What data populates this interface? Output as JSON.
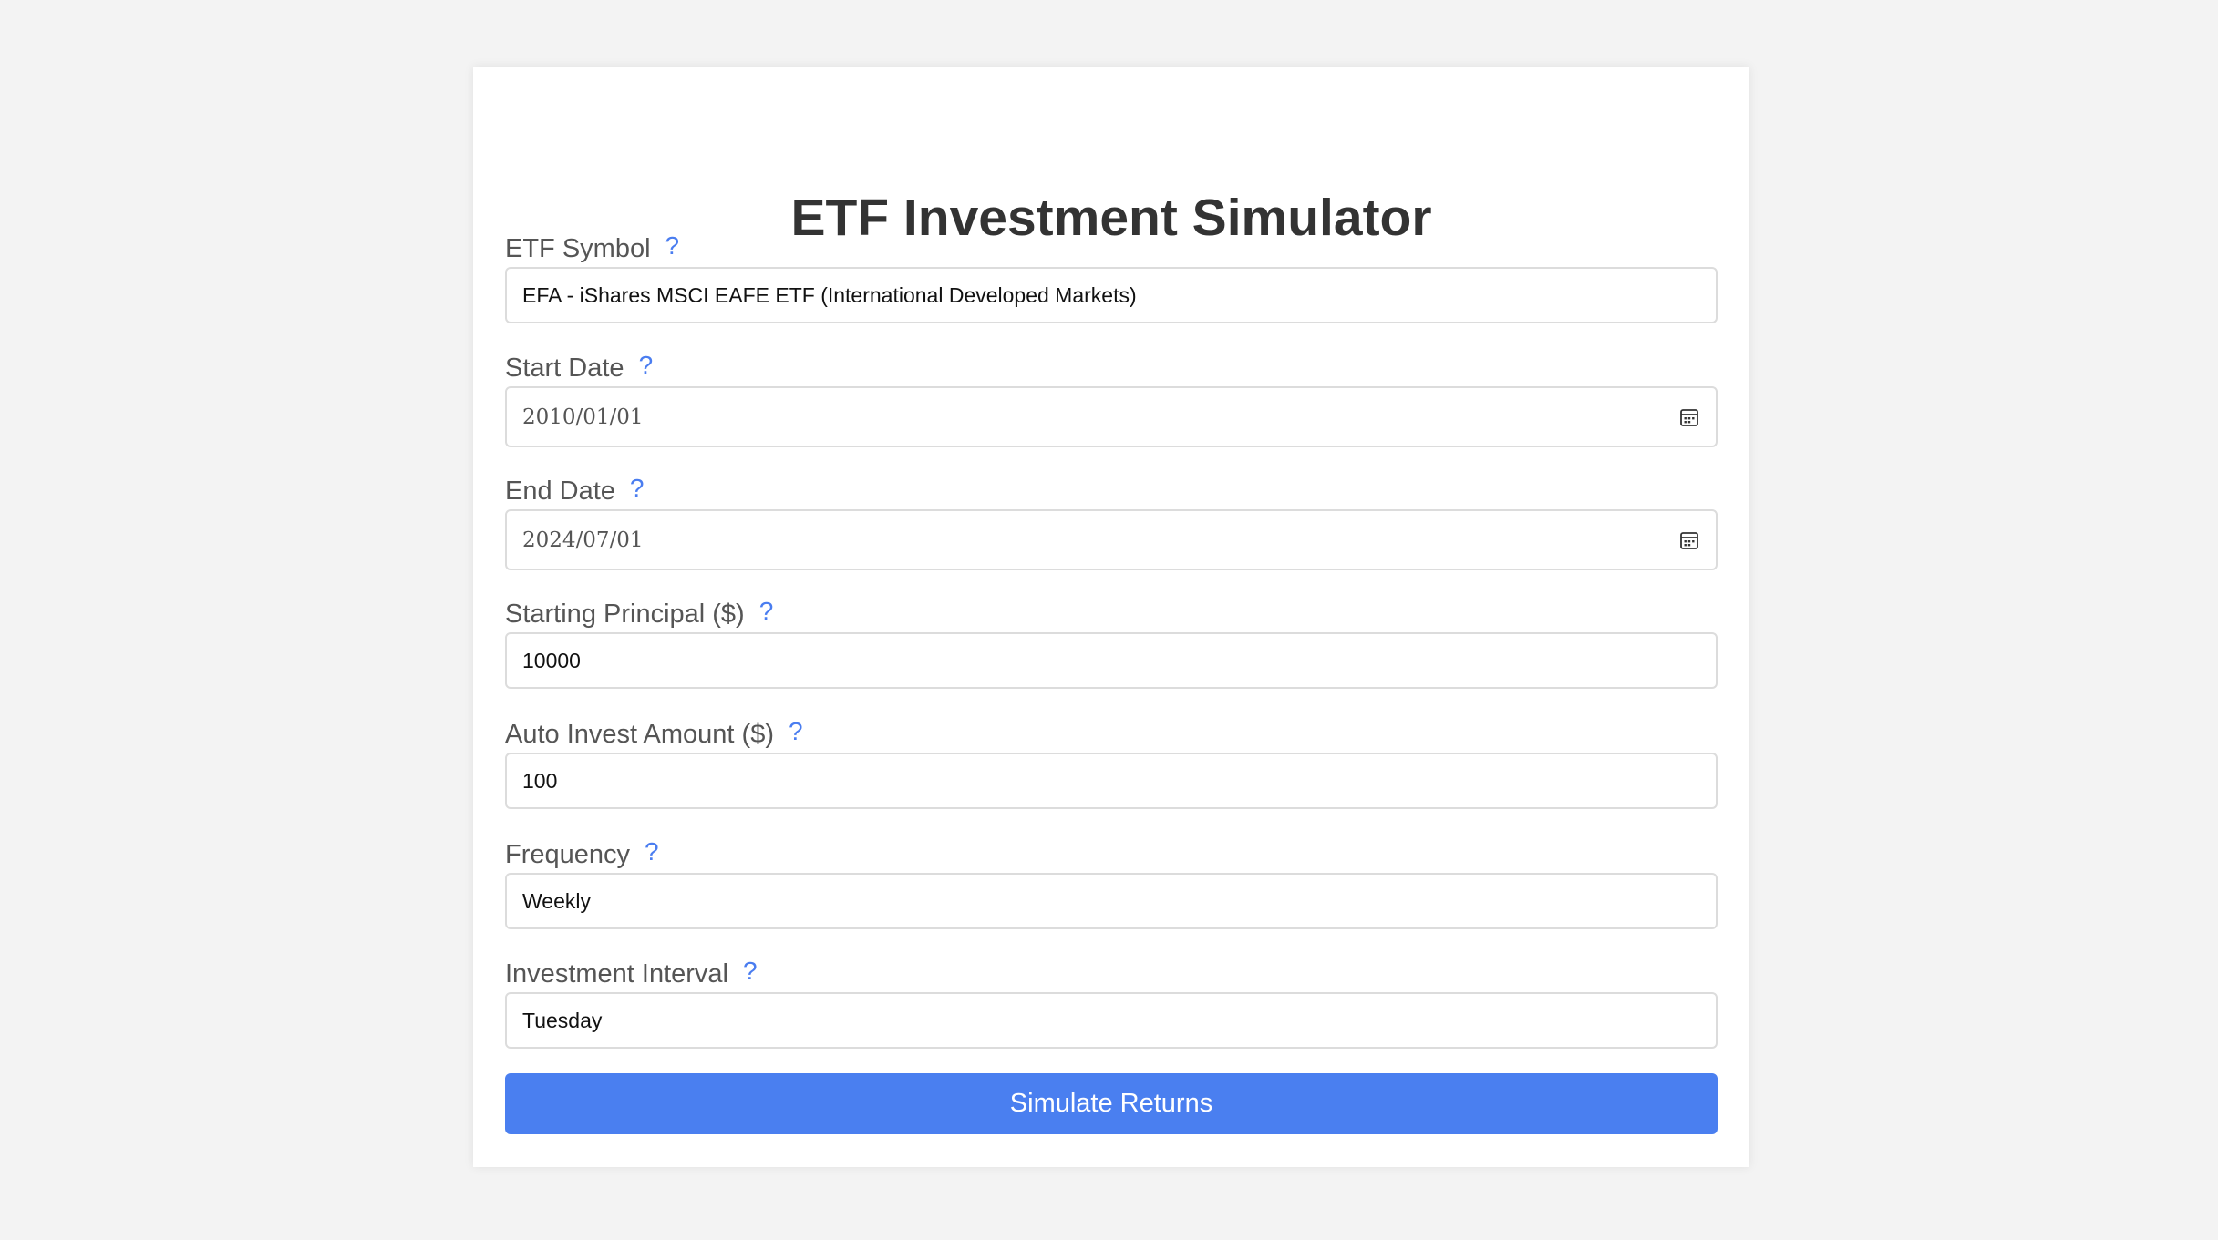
{
  "page": {
    "title": "ETF Investment Simulator"
  },
  "help_glyph": "?",
  "fields": [
    {
      "label": "ETF Symbol",
      "value": "EFA - iShares MSCI EAFE ETF (International Developed Markets)",
      "type": "select"
    },
    {
      "label": "Start Date",
      "value": "2010/01/01",
      "type": "date"
    },
    {
      "label": "End Date",
      "value": "2024/07/01",
      "type": "date"
    },
    {
      "label": "Starting Principal ($)",
      "value": "10000",
      "type": "number"
    },
    {
      "label": "Auto Invest Amount ($)",
      "value": "100",
      "type": "number"
    },
    {
      "label": "Frequency",
      "value": "Weekly",
      "type": "select"
    },
    {
      "label": "Investment Interval",
      "value": "Tuesday",
      "type": "select"
    }
  ],
  "submit_label": "Simulate Returns",
  "colors": {
    "accent": "#4a7ff0",
    "help_icon": "#4a7df0",
    "background": "#f3f3f3",
    "card": "#ffffff"
  },
  "icons": {
    "date_field": "calendar-icon",
    "help": "help-icon"
  }
}
